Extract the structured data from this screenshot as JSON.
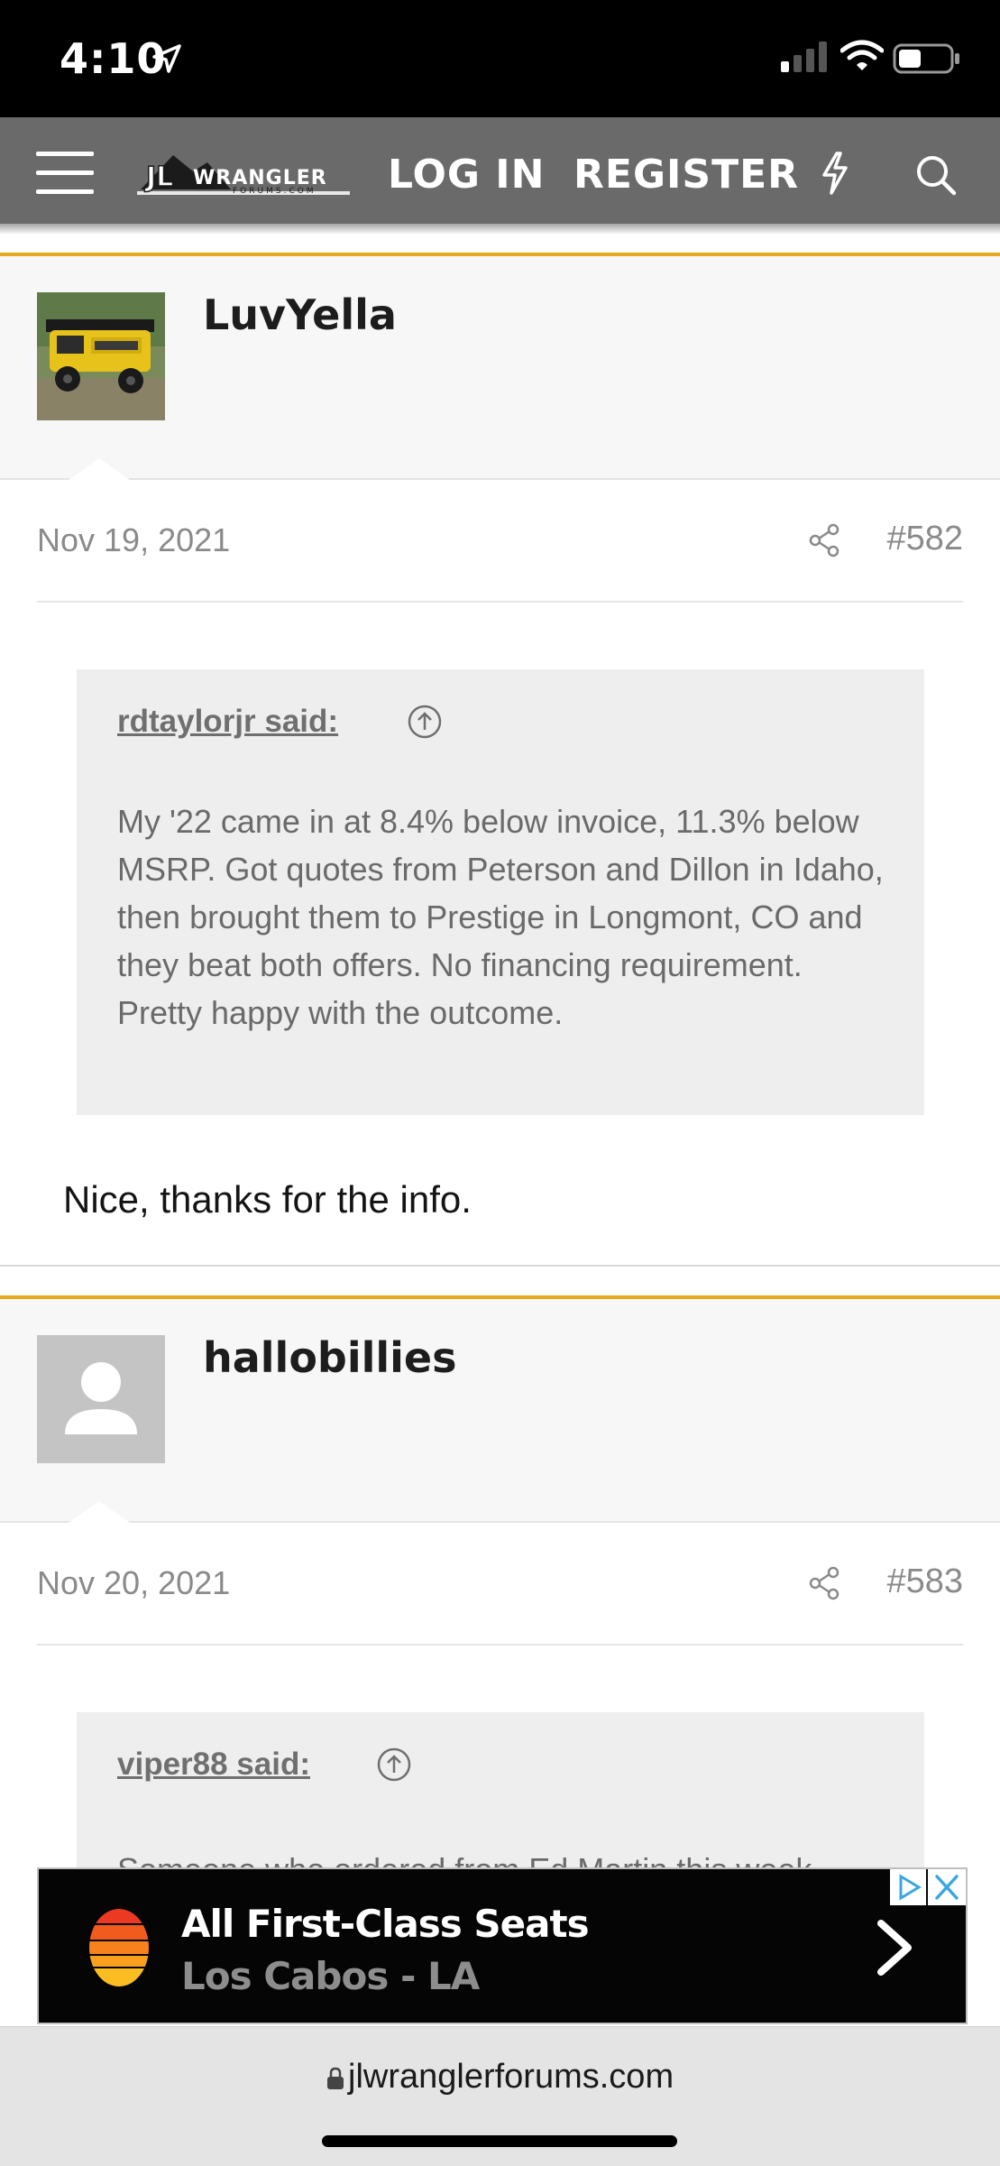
{
  "status_bar": {
    "time": "4:10"
  },
  "nav": {
    "logo_main": "WRANGLER",
    "logo_sub": "FORUMS.COM",
    "logo_badge": "JL",
    "login": "LOG IN",
    "register": "REGISTER"
  },
  "posts": [
    {
      "username": "LuvYella",
      "date": "Nov 19, 2021",
      "number": "#582",
      "quote_author": "rdtaylorjr said:",
      "quote_text": "My '22 came in at 8.4% below invoice, 11.3% below MSRP. Got quotes from Peterson and Dillon in Idaho, then brought them to Prestige in Longmont, CO and they beat both offers. No financing requirement. Pretty happy with the outcome.",
      "reply": "Nice, thanks for the info."
    },
    {
      "username": "hallobillies",
      "date": "Nov 20, 2021",
      "number": "#583",
      "quote_author": "viper88 said:",
      "quote_text": "Someone who ordered from Ed Martin this week"
    }
  ],
  "ad": {
    "title": "All First-Class Seats",
    "subtitle": "Los Cabos - LA"
  },
  "browser": {
    "url": "jlwranglerforums.com"
  },
  "colors": {
    "accent": "#e5a91f",
    "navbar": "#6a6a6a",
    "quote_bg": "#eeeeee"
  }
}
